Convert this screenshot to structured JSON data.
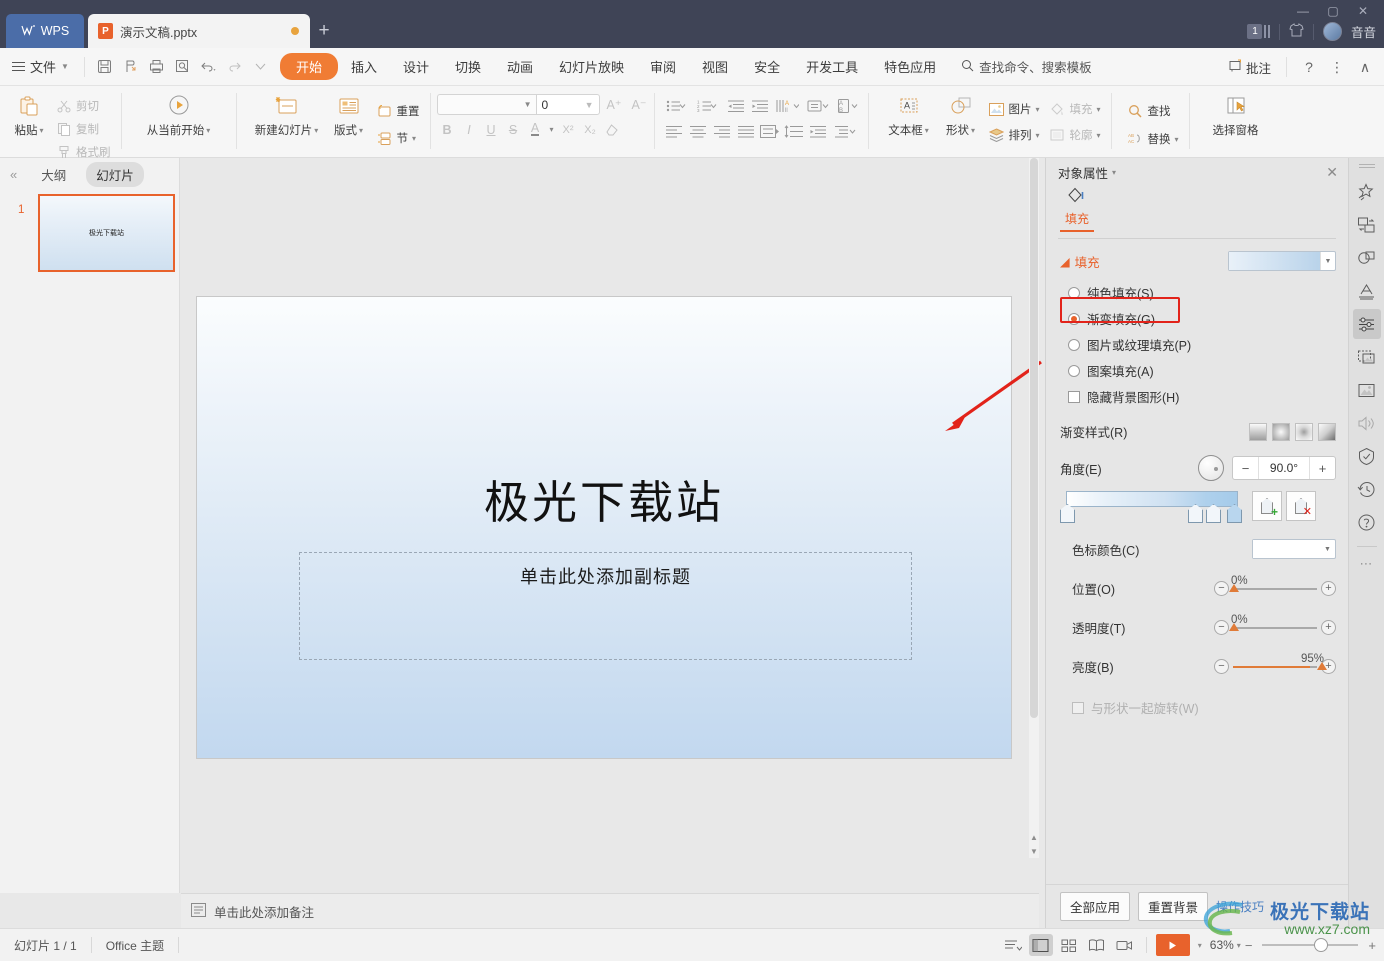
{
  "titlebar": {
    "wps_label": "WPS",
    "doc_tab": "演示文稿.pptx",
    "new_tab": "+",
    "minimize": "—",
    "maximize": "▢",
    "close": "✕",
    "badge_count": "1",
    "username": "音音"
  },
  "menubar": {
    "file_label": "文件",
    "items": [
      {
        "label": "开始",
        "active": true
      },
      {
        "label": "插入",
        "active": false
      },
      {
        "label": "设计",
        "active": false
      },
      {
        "label": "切换",
        "active": false
      },
      {
        "label": "动画",
        "active": false
      },
      {
        "label": "幻灯片放映",
        "active": false
      },
      {
        "label": "审阅",
        "active": false
      },
      {
        "label": "视图",
        "active": false
      },
      {
        "label": "安全",
        "active": false
      },
      {
        "label": "开发工具",
        "active": false
      },
      {
        "label": "特色应用",
        "active": false
      }
    ],
    "search_placeholder": "查找命令、搜索模板",
    "comment_label": "批注",
    "help_label": "?",
    "more_label": "⋮",
    "collapse_label": "∧"
  },
  "ribbon": {
    "paste": "粘贴",
    "cut": "剪切",
    "copy": "复制",
    "format_painter": "格式刷",
    "start_from_current": "从当前开始",
    "new_slide": "新建幻灯片",
    "layout": "版式",
    "reset": "重置",
    "section": "节",
    "font_name": "",
    "font_size": "0",
    "grow_font": "A⁺",
    "shrink_font": "A⁻",
    "bold": "B",
    "italic": "I",
    "underline": "U",
    "strikethrough": "S",
    "font_color": "A",
    "superscript": "X²",
    "subscript": "X₂",
    "clear_format": "◇",
    "textbox": "文本框",
    "shape": "形状",
    "picture": "图片",
    "arrange": "排列",
    "fill": "填充",
    "outline": "轮廓",
    "find": "查找",
    "replace": "替换",
    "select_pane": "选择窗格"
  },
  "left_panel": {
    "collapse": "«",
    "tab_outline": "大纲",
    "tab_slides": "幻灯片",
    "slide_number": "1",
    "thumb_title": "极光下载站"
  },
  "slide": {
    "title": "极光下载站",
    "subtitle_placeholder": "单击此处添加副标题"
  },
  "notes": {
    "placeholder": "单击此处添加备注"
  },
  "right_panel": {
    "header_title": "对象属性",
    "close": "✕",
    "tab_fill": "填充",
    "section_fill": "填充",
    "fill_options": [
      {
        "label": "纯色填充(S)",
        "selected": false
      },
      {
        "label": "渐变填充(G)",
        "selected": true
      },
      {
        "label": "图片或纹理填充(P)",
        "selected": false
      },
      {
        "label": "图案填充(A)",
        "selected": false
      }
    ],
    "hide_bg_graphics": "隐藏背景图形(H)",
    "gradient_style_label": "渐变样式(R)",
    "angle_label": "角度(E)",
    "angle_value": "90.0°",
    "minus": "−",
    "plus": "+",
    "stop_color_label": "色标颜色(C)",
    "position_label": "位置(O)",
    "position_value": "0%",
    "transparency_label": "透明度(T)",
    "transparency_value": "0%",
    "brightness_label": "亮度(B)",
    "brightness_value": "95%",
    "rotate_with_shape": "与形状一起旋转(W)",
    "apply_all": "全部应用",
    "reset_bg": "重置背景",
    "tips_link": "操作技巧"
  },
  "statusbar": {
    "slide_counter": "幻灯片 1 / 1",
    "theme": "Office 主题",
    "zoom": "63%",
    "zoom_out": "−",
    "zoom_in": "+"
  },
  "watermark": {
    "line1": "极光下载站",
    "line2": "www.xz7.com"
  },
  "colors": {
    "accent": "#e8622c",
    "titlebar_bg": "#3f4456",
    "highlight_red": "#e2231a",
    "link_blue": "#4a7fc1"
  }
}
